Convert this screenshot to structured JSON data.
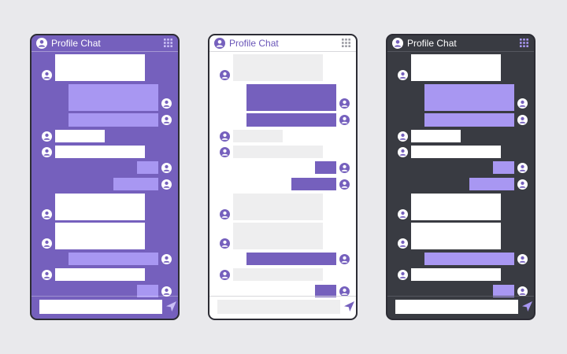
{
  "phones": [
    {
      "id": "purple",
      "title": "Profile Chat",
      "input_placeholder": "",
      "colors": {
        "frame": "#7560bd",
        "incoming": "#ffffff",
        "outgoing": "#a897f2",
        "avatar_bg": "#ffffff",
        "avatar_fg": "#7560bd",
        "header_text": "#ffffff"
      }
    },
    {
      "id": "white",
      "title": "Profile Chat",
      "input_placeholder": "",
      "colors": {
        "frame": "#ffffff",
        "incoming": "#eeeeef",
        "outgoing": "#7560bd",
        "avatar_bg": "#7560bd",
        "avatar_fg": "#ffffff",
        "header_text": "#6a56b8"
      }
    },
    {
      "id": "dark",
      "title": "Profile Chat",
      "input_placeholder": "",
      "colors": {
        "frame": "#393b42",
        "incoming": "#ffffff",
        "outgoing": "#a897f2",
        "avatar_bg": "#ffffff",
        "avatar_fg": "#7560bd",
        "header_text": "#ffffff"
      }
    }
  ],
  "messages": [
    {
      "side": "incoming",
      "lines": 2
    },
    {
      "side": "outgoing",
      "lines": 2
    },
    {
      "side": "outgoing",
      "lines": 1
    },
    {
      "side": "incoming",
      "lines": 1
    },
    {
      "side": "incoming",
      "lines": 1
    },
    {
      "side": "outgoing",
      "lines": 1
    },
    {
      "side": "outgoing",
      "lines": 1
    },
    {
      "side": "incoming",
      "lines": 2
    },
    {
      "side": "incoming",
      "lines": 2
    },
    {
      "side": "outgoing",
      "lines": 1
    },
    {
      "side": "incoming",
      "lines": 1
    },
    {
      "side": "outgoing",
      "lines": 1
    }
  ],
  "icons": {
    "header_avatar": "user-avatar-icon",
    "menu": "grid-menu-icon",
    "send": "send-icon",
    "message_avatar": "user-avatar-icon"
  }
}
